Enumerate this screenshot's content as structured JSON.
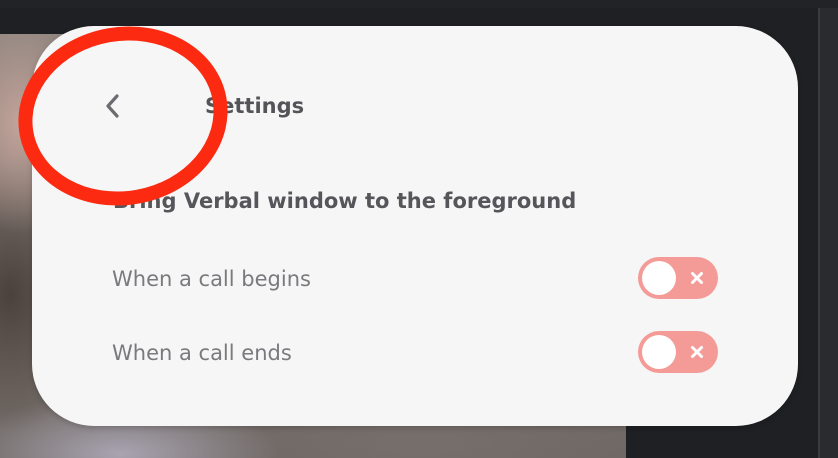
{
  "header": {
    "back_icon": "chevron-left-icon",
    "title": "Settings"
  },
  "section": {
    "heading": "Bring Verbal window to the foreground"
  },
  "rows": [
    {
      "label": "When a call begins",
      "toggle_on": false
    },
    {
      "label": "When a call ends",
      "toggle_on": false
    }
  ],
  "colors": {
    "panel_bg": "#f6f6f6",
    "toggle_off": "#f49b97",
    "annotation": "#fc2a10",
    "title_text": "#545458",
    "label_text": "#7a7a7e"
  }
}
